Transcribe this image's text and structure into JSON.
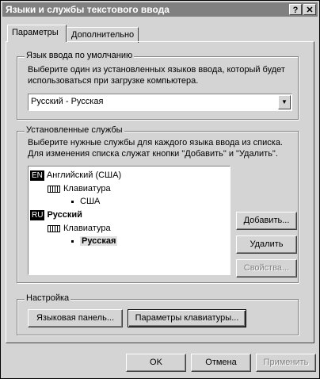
{
  "window": {
    "title": "Языки и службы текстового ввода",
    "help_btn": "?",
    "close_btn": "✕"
  },
  "tabs": [
    {
      "label": "Параметры",
      "active": true
    },
    {
      "label": "Дополнительно",
      "active": false
    }
  ],
  "default_lang": {
    "legend": "Язык ввода по умолчанию",
    "desc_line1": "Выберите один из установленных языков ввода, который будет",
    "desc_line2": "использоваться при загрузке компьютера.",
    "selected": "Русский - Русская"
  },
  "services": {
    "legend": "Установленные службы",
    "desc_line1": "Выберите нужные службы для каждого языка ввода из списка.",
    "desc_line2": "Для изменения списка служат кнопки \"Добавить\" и \"Удалить\".",
    "tree": {
      "en_badge": "EN",
      "en_label": "Английский (США)",
      "en_kbd": "Клавиатура",
      "en_layout": "США",
      "ru_badge": "RU",
      "ru_label": "Русский",
      "ru_kbd": "Клавиатура",
      "ru_layout": "Русская"
    },
    "add_btn": "Добавить...",
    "remove_btn": "Удалить",
    "props_btn": "Свойства..."
  },
  "settings": {
    "legend": "Настройка",
    "langbar_btn": "Языковая панель...",
    "kbd_btn": "Параметры клавиатуры..."
  },
  "footer": {
    "ok": "OK",
    "cancel": "Отмена",
    "apply": "Применить"
  }
}
